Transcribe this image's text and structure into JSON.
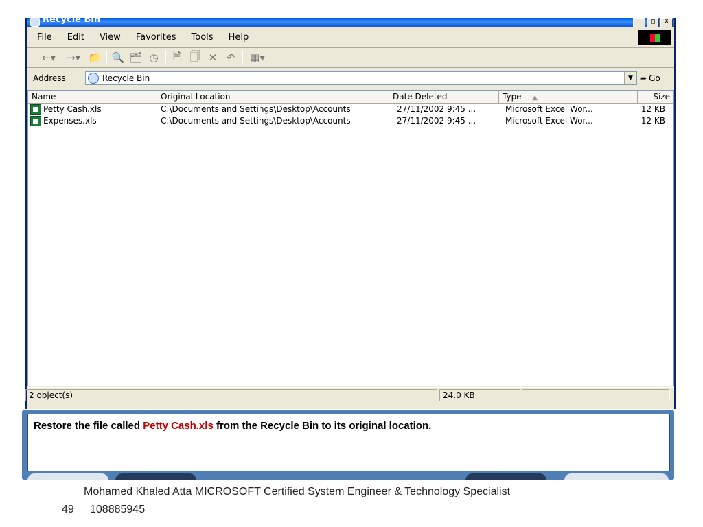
{
  "window": {
    "title": "Recycle Bin",
    "controls": [
      "_",
      "□",
      "X"
    ]
  },
  "menu": {
    "items": [
      "File",
      "Edit",
      "View",
      "Favorites",
      "Tools",
      "Help"
    ]
  },
  "toolbar": {
    "buttons": [
      "back-icon",
      "forward-icon",
      "up-icon",
      "search-icon",
      "folders-icon",
      "history-icon",
      "move-to-icon",
      "copy-to-icon",
      "delete-icon",
      "undo-icon",
      "views-icon"
    ]
  },
  "address": {
    "label": "Address",
    "value": "Recycle Bin",
    "go_label": "Go"
  },
  "list": {
    "columns": [
      "Name",
      "Original Location",
      "Date Deleted",
      "Type",
      "Size"
    ],
    "sort_indicator": "▲",
    "rows": [
      {
        "name": "Petty Cash.xls",
        "location": "C:\\Documents and Settings\\Desktop\\Accounts",
        "date": "27/11/2002 9:45 ...",
        "type": "Microsoft Excel Wor...",
        "size": "12 KB"
      },
      {
        "name": "Expenses.xls",
        "location": "C:\\Documents and Settings\\Desktop\\Accounts",
        "date": "27/11/2002 9:45 ...",
        "type": "Microsoft Excel Wor...",
        "size": "12 KB"
      }
    ]
  },
  "status": {
    "objects": "2 object(s)",
    "size": "24.0 KB"
  },
  "task": {
    "prefix": "Restore the file called ",
    "highlight": "Petty Cash.xls",
    "suffix": " from the Recycle Bin to its original location.",
    "highlight_color": "#c00000"
  },
  "footer": {
    "credit": "Mohamed Khaled Atta MICROSOFT Certified System Engineer & Technology Specialist",
    "page_number": "49",
    "phone": "108885945"
  }
}
